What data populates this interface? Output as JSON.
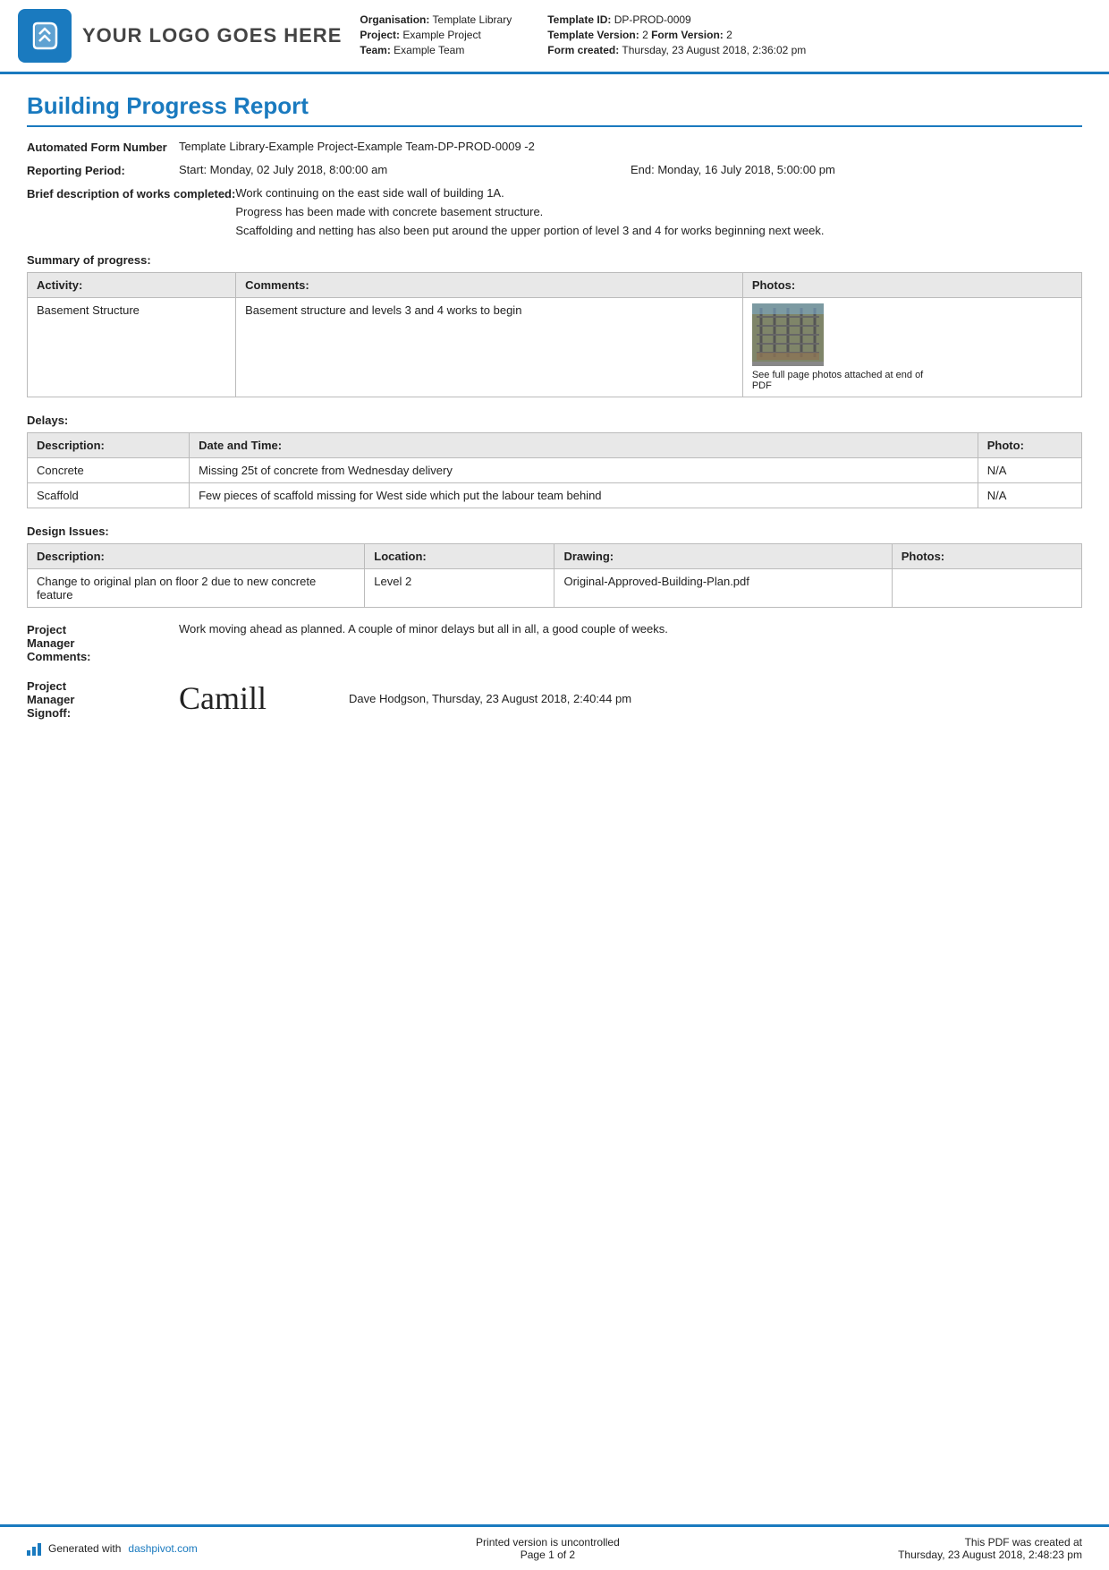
{
  "header": {
    "logo_text": "YOUR LOGO GOES HERE",
    "org_label": "Organisation:",
    "org_value": "Template Library",
    "project_label": "Project:",
    "project_value": "Example Project",
    "team_label": "Team:",
    "team_value": "Example Team",
    "template_id_label": "Template ID:",
    "template_id_value": "DP-PROD-0009",
    "template_version_label": "Template Version:",
    "template_version_value": "2",
    "form_version_label": "Form Version:",
    "form_version_value": "2",
    "form_created_label": "Form created:",
    "form_created_value": "Thursday, 23 August 2018, 2:36:02 pm"
  },
  "report": {
    "title": "Building Progress Report",
    "automated_form_number_label": "Automated Form Number",
    "automated_form_number_value": "Template Library-Example Project-Example Team-DP-PROD-0009   -2",
    "reporting_period_label": "Reporting Period:",
    "reporting_period_start": "Start: Monday, 02 July 2018, 8:00:00 am",
    "reporting_period_end": "End: Monday, 16 July 2018, 5:00:00 pm",
    "brief_description_label": "Brief description of works completed:",
    "brief_description_lines": [
      "Work continuing on the east side wall of building 1A.",
      "Progress has been made with concrete basement structure.",
      "Scaffolding and netting has also been put around the upper portion of level 3 and 4 for works beginning next week."
    ],
    "summary_section_label": "Summary of progress:",
    "summary_table": {
      "headers": [
        "Activity:",
        "Comments:",
        "Photos:"
      ],
      "rows": [
        {
          "activity": "Basement Structure",
          "comments": "Basement structure and levels 3 and 4 works to begin",
          "photo_caption": "See full page photos attached at end of PDF"
        }
      ]
    },
    "delays_section_label": "Delays:",
    "delays_table": {
      "headers": [
        "Description:",
        "Date and Time:",
        "Photo:"
      ],
      "rows": [
        {
          "description": "Concrete",
          "date_time": "Missing 25t of concrete from Wednesday delivery",
          "photo": "N/A"
        },
        {
          "description": "Scaffold",
          "date_time": "Few pieces of scaffold missing for West side which put the labour team behind",
          "photo": "N/A"
        }
      ]
    },
    "design_issues_section_label": "Design Issues:",
    "design_issues_table": {
      "headers": [
        "Description:",
        "Location:",
        "Drawing:",
        "Photos:"
      ],
      "rows": [
        {
          "description": "Change to original plan on floor 2 due to new concrete feature",
          "location": "Level 2",
          "drawing": "Original-Approved-Building-Plan.pdf",
          "photos": ""
        }
      ]
    },
    "pm_comments_label": "Project Manager Comments:",
    "pm_comments_value": "Work moving ahead as planned. A couple of minor delays but all in all, a good couple of weeks.",
    "pm_signoff_label": "Project Manager Signoff:",
    "pm_signature": "Camill",
    "pm_signoff_name": "Dave Hodgson, Thursday, 23 August 2018, 2:40:44 pm"
  },
  "footer": {
    "generated_text": "Generated with",
    "generated_link": "dashpivot.com",
    "uncontrolled_text": "Printed version is uncontrolled",
    "page_text": "Page 1 of 2",
    "pdf_created_text": "This PDF was created at",
    "pdf_created_value": "Thursday, 23 August 2018, 2:48:23 pm"
  }
}
